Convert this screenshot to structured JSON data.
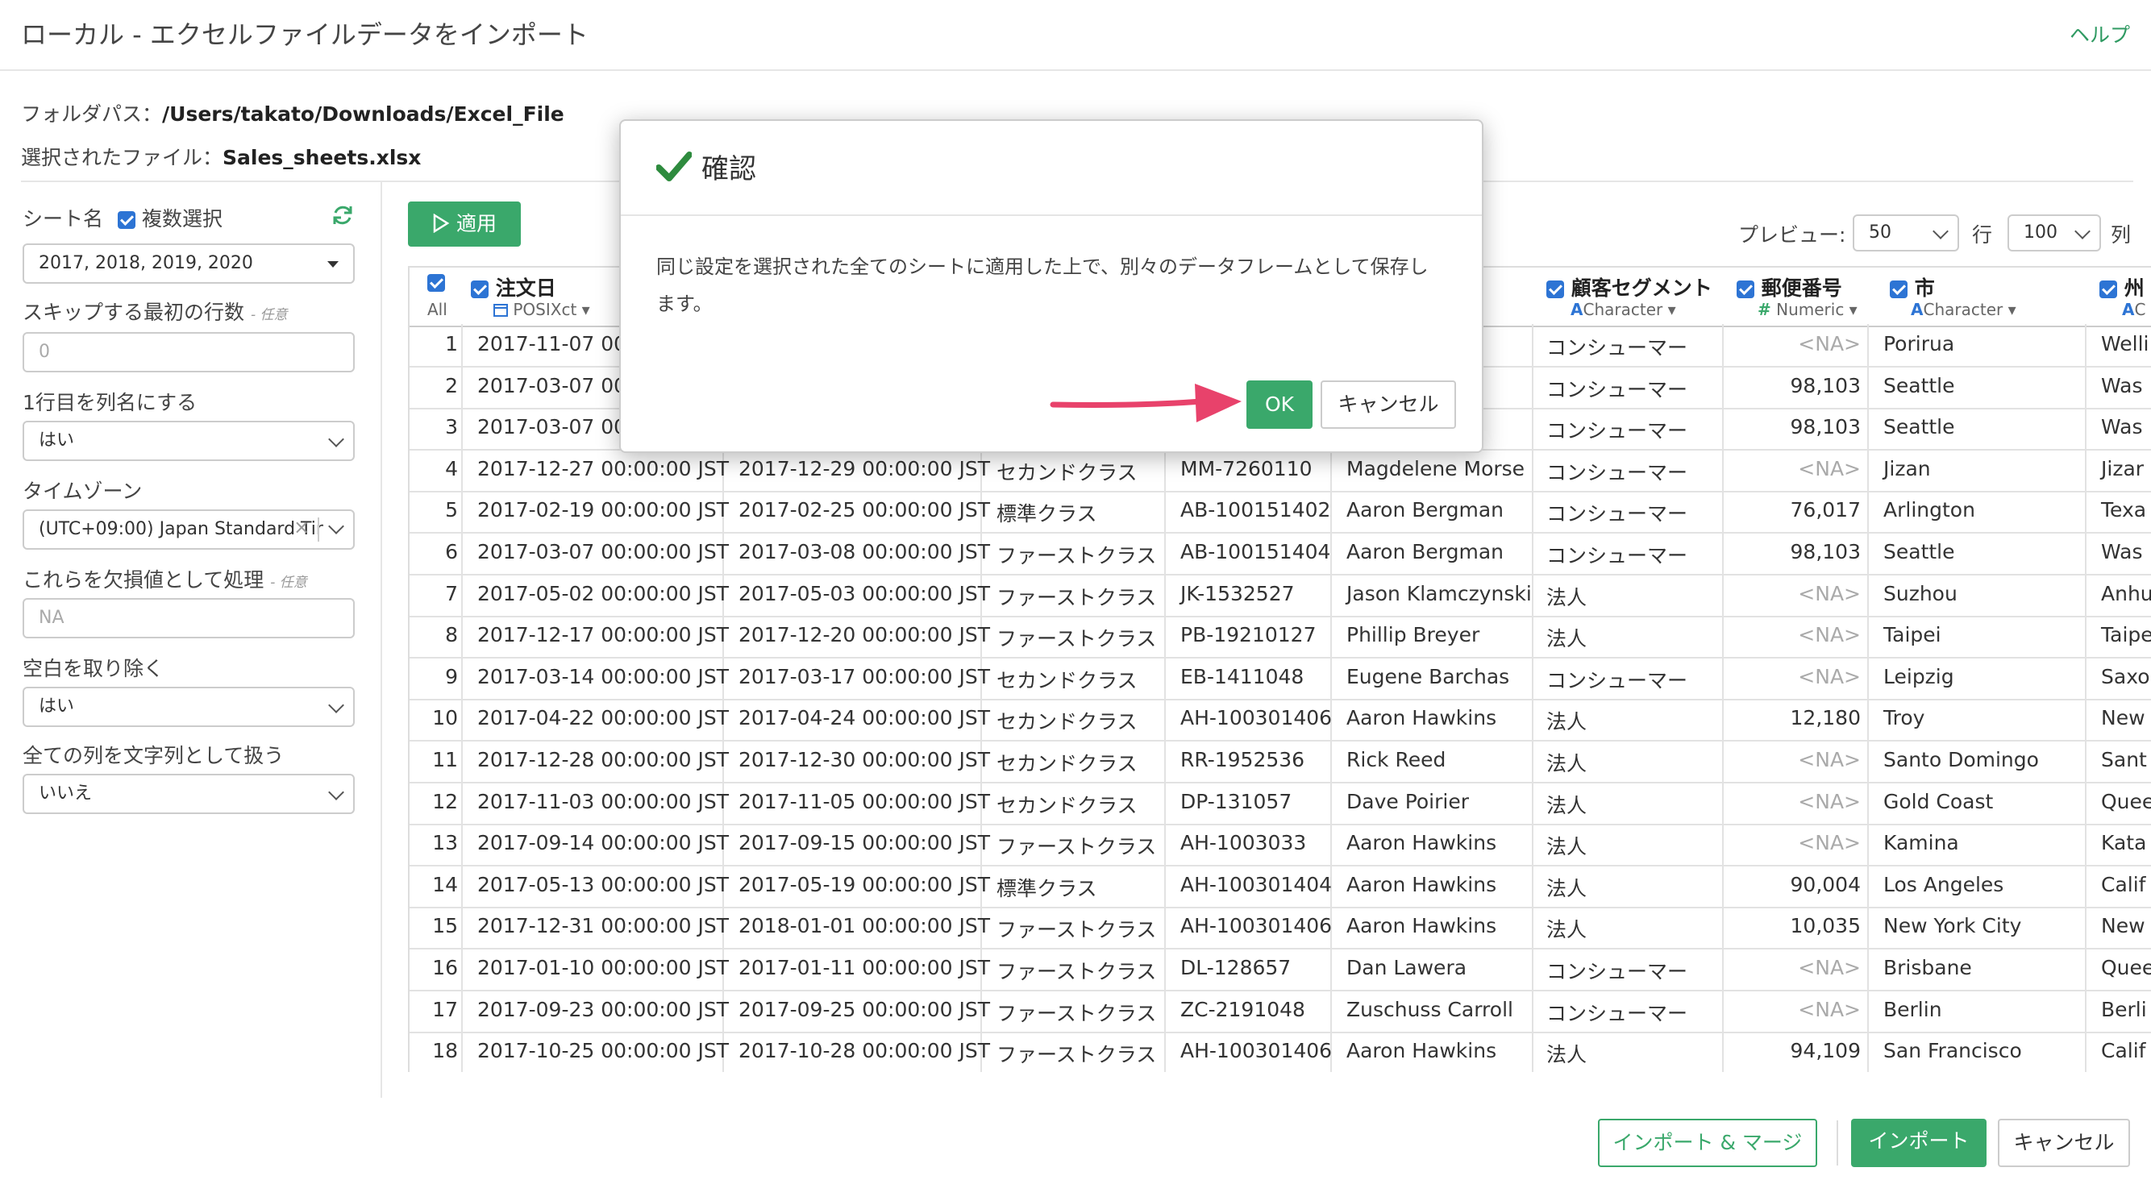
{
  "header": {
    "title": "ローカル - エクセルファイルデータをインポート",
    "help": "ヘルプ"
  },
  "info": {
    "folder_label": "フォルダパス：",
    "folder_value": "/Users/takato/Downloads/Excel_File",
    "file_label": "選択されたファイル：",
    "file_value": "Sales_sheets.xlsx"
  },
  "left_panel": {
    "sheet_label": "シート名",
    "multi_select_label": "複数選択",
    "sheet_value": "2017, 2018, 2019, 2020",
    "skip_label": "スキップする最初の行数",
    "optional": "- 任意",
    "skip_placeholder": "0",
    "first_row_label": "1行目を列名にする",
    "first_row_value": "はい",
    "timezone_label": "タイムゾーン",
    "timezone_value": "(UTC+09:00) Japan Standard Tir",
    "na_label": "これらを欠損値として処理",
    "na_placeholder": "NA",
    "trim_label": "空白を取り除く",
    "trim_value": "はい",
    "as_string_label": "全ての列を文字列として扱う",
    "as_string_value": "いいえ"
  },
  "toolbar": {
    "apply_label": "適用",
    "preview_label": "プレビュー:",
    "preview_value": "50",
    "rows_unit": "行",
    "cols_value": "100",
    "cols_unit": "列"
  },
  "table": {
    "all_label": "All",
    "columns": [
      {
        "name": "注文日",
        "type": "POSIXct"
      },
      {
        "name": "顧客セグメント",
        "type": "Character"
      },
      {
        "name": "郵便番号",
        "type": "Numeric"
      },
      {
        "name": "市",
        "type": "Character"
      },
      {
        "name": "州",
        "type": "C"
      }
    ],
    "rows": [
      [
        "1",
        "2017-11-07 00:0",
        "",
        "",
        "",
        "",
        "コンシューマー",
        "<NA>",
        "Porirua",
        "Welli"
      ],
      [
        "2",
        "2017-03-07 00:0",
        "",
        "",
        "",
        "n",
        "コンシューマー",
        "98,103",
        "Seattle",
        "Was"
      ],
      [
        "3",
        "2017-03-07 00:0",
        "",
        "",
        "",
        "n",
        "コンシューマー",
        "98,103",
        "Seattle",
        "Was"
      ],
      [
        "4",
        "2017-12-27 00:00:00 JST",
        "2017-12-29 00:00:00 JST",
        "セカンドクラス",
        "MM-7260110",
        "Magdelene Morse",
        "コンシューマー",
        "<NA>",
        "Jizan",
        "Jizar"
      ],
      [
        "5",
        "2017-02-19 00:00:00 JST",
        "2017-02-25 00:00:00 JST",
        "標準クラス",
        "AB-100151402",
        "Aaron Bergman",
        "コンシューマー",
        "76,017",
        "Arlington",
        "Texa"
      ],
      [
        "6",
        "2017-03-07 00:00:00 JST",
        "2017-03-08 00:00:00 JST",
        "ファーストクラス",
        "AB-100151404",
        "Aaron Bergman",
        "コンシューマー",
        "98,103",
        "Seattle",
        "Was"
      ],
      [
        "7",
        "2017-05-02 00:00:00 JST",
        "2017-05-03 00:00:00 JST",
        "ファーストクラス",
        "JK-1532527",
        "Jason Klamczynski",
        "法人",
        "<NA>",
        "Suzhou",
        "Anhu"
      ],
      [
        "8",
        "2017-12-17 00:00:00 JST",
        "2017-12-20 00:00:00 JST",
        "ファーストクラス",
        "PB-19210127",
        "Phillip Breyer",
        "法人",
        "<NA>",
        "Taipei",
        "Taipe"
      ],
      [
        "9",
        "2017-03-14 00:00:00 JST",
        "2017-03-17 00:00:00 JST",
        "セカンドクラス",
        "EB-1411048",
        "Eugene Barchas",
        "コンシューマー",
        "<NA>",
        "Leipzig",
        "Saxo"
      ],
      [
        "10",
        "2017-04-22 00:00:00 JST",
        "2017-04-24 00:00:00 JST",
        "セカンドクラス",
        "AH-100301406",
        "Aaron Hawkins",
        "法人",
        "12,180",
        "Troy",
        "New"
      ],
      [
        "11",
        "2017-12-28 00:00:00 JST",
        "2017-12-30 00:00:00 JST",
        "セカンドクラス",
        "RR-1952536",
        "Rick Reed",
        "法人",
        "<NA>",
        "Santo Domingo",
        "Sant"
      ],
      [
        "12",
        "2017-11-03 00:00:00 JST",
        "2017-11-05 00:00:00 JST",
        "セカンドクラス",
        "DP-131057",
        "Dave Poirier",
        "法人",
        "<NA>",
        "Gold Coast",
        "Quee"
      ],
      [
        "13",
        "2017-09-14 00:00:00 JST",
        "2017-09-15 00:00:00 JST",
        "ファーストクラス",
        "AH-1003033",
        "Aaron Hawkins",
        "法人",
        "<NA>",
        "Kamina",
        "Kata"
      ],
      [
        "14",
        "2017-05-13 00:00:00 JST",
        "2017-05-19 00:00:00 JST",
        "標準クラス",
        "AH-100301404",
        "Aaron Hawkins",
        "法人",
        "90,004",
        "Los Angeles",
        "Calif"
      ],
      [
        "15",
        "2017-12-31 00:00:00 JST",
        "2018-01-01 00:00:00 JST",
        "ファーストクラス",
        "AH-100301406",
        "Aaron Hawkins",
        "法人",
        "10,035",
        "New York City",
        "New"
      ],
      [
        "16",
        "2017-01-10 00:00:00 JST",
        "2017-01-11 00:00:00 JST",
        "ファーストクラス",
        "DL-128657",
        "Dan Lawera",
        "コンシューマー",
        "<NA>",
        "Brisbane",
        "Quee"
      ],
      [
        "17",
        "2017-09-23 00:00:00 JST",
        "2017-09-25 00:00:00 JST",
        "ファーストクラス",
        "ZC-2191048",
        "Zuschuss Carroll",
        "コンシューマー",
        "<NA>",
        "Berlin",
        "Berli"
      ],
      [
        "18",
        "2017-10-25 00:00:00 JST",
        "2017-10-28 00:00:00 JST",
        "ファーストクラス",
        "AH-100301406",
        "Aaron Hawkins",
        "法人",
        "94,109",
        "San Francisco",
        "Calif"
      ]
    ]
  },
  "dialog": {
    "title": "確認",
    "message": "同じ設定を選択された全てのシートに適用した上で、別々のデータフレームとして保存します。",
    "ok": "OK",
    "cancel": "キャンセル"
  },
  "footer": {
    "import_merge": "インポート & マージ",
    "import": "インポート",
    "cancel": "キャンセル"
  },
  "colors": {
    "accent_green": "#3aa86b",
    "checkbox_blue": "#2d74d4",
    "arrow_pink": "#e8426b"
  }
}
